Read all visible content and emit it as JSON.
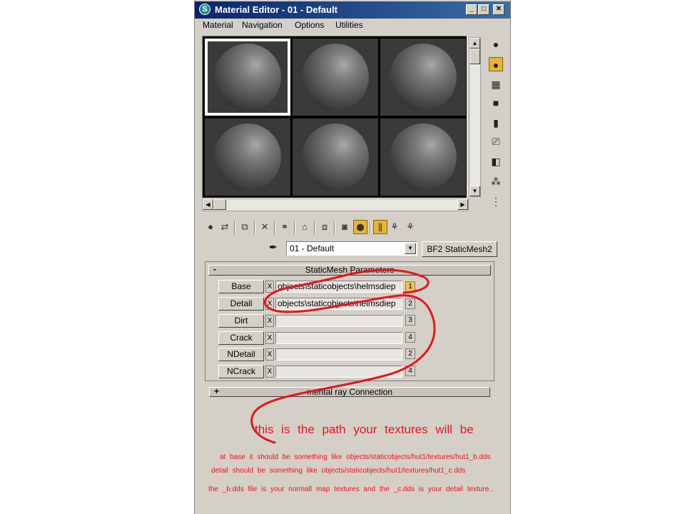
{
  "window": {
    "title": "Material Editor - 01 - Default",
    "app_icon": "max-app-icon",
    "controls": [
      "minimize-icon",
      "maximize-icon",
      "close-icon"
    ]
  },
  "menu": [
    "Material",
    "Navigation",
    "Options",
    "Utilities"
  ],
  "material_name": "01 - Default",
  "material_type": "BF2 StaticMesh2",
  "rollouts": {
    "params": {
      "sign": "-",
      "title": "StaticMesh Parameters"
    },
    "mental_ray": {
      "sign": "+",
      "title": "mental ray Connection"
    }
  },
  "maps": [
    {
      "label": "Base",
      "clear": "X",
      "path": "objects\\staticobjects\\helmsdiep",
      "channel": "1"
    },
    {
      "label": "Detail",
      "clear": "X",
      "path": "objects\\staticobjects\\helmsdiep",
      "channel": "2"
    },
    {
      "label": "Dirt",
      "clear": "X",
      "path": "",
      "channel": "3"
    },
    {
      "label": "Crack",
      "clear": "X",
      "path": "",
      "channel": "4"
    },
    {
      "label": "NDetail",
      "clear": "X",
      "path": "",
      "channel": "2"
    },
    {
      "label": "NCrack",
      "clear": "X",
      "path": "",
      "channel": "4"
    }
  ],
  "annotations": {
    "main": "this is the path your textures will be",
    "line1": "at base it should be something like objects/staticobjects/hut1/textures/hut1_b.dds",
    "line2": "detail should be something like objects/staticobjects/hut1/textures/hut1_c.dds",
    "line3": "the _b.dds file is your normall map textures and the _c.dds is your detail texture..",
    "color": "#e8141e"
  },
  "colors": {
    "highlight": "#e6b43a",
    "panel": "#d4d0c8",
    "titlebar": "#0a246a"
  }
}
